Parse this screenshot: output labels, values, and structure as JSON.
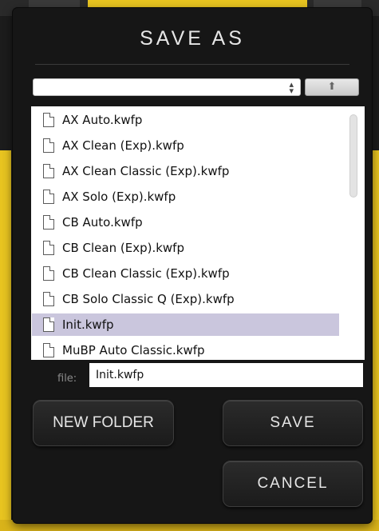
{
  "dialog": {
    "title": "SAVE AS",
    "path_select": {
      "value": ""
    },
    "up_button_icon": "up-arrow-icon",
    "files": [
      {
        "name": "AX Auto.kwfp",
        "selected": false
      },
      {
        "name": "AX Clean (Exp).kwfp",
        "selected": false
      },
      {
        "name": "AX Clean Classic (Exp).kwfp",
        "selected": false
      },
      {
        "name": "AX Solo (Exp).kwfp",
        "selected": false
      },
      {
        "name": "CB Auto.kwfp",
        "selected": false
      },
      {
        "name": "CB Clean (Exp).kwfp",
        "selected": false
      },
      {
        "name": "CB Clean Classic (Exp).kwfp",
        "selected": false
      },
      {
        "name": "CB Solo Classic Q (Exp).kwfp",
        "selected": false
      },
      {
        "name": "Init.kwfp",
        "selected": true
      },
      {
        "name": "MuBP Auto Classic.kwfp",
        "selected": false
      }
    ],
    "file_label": "file:",
    "file_value": "Init.kwfp",
    "buttons": {
      "new_folder": "NEW FOLDER",
      "save": "SAVE",
      "cancel": "CANCEL"
    }
  },
  "colors": {
    "selection": "#cac6dd",
    "accent_yellow": "#e8c420",
    "dialog_bg": "#161616"
  }
}
